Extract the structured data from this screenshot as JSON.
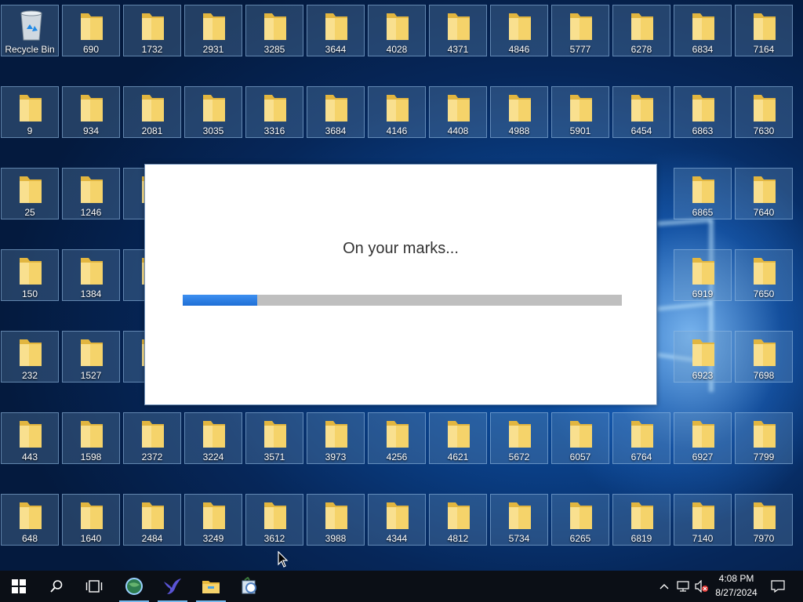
{
  "desktop": {
    "recycle_bin_label": "Recycle Bin",
    "rows": [
      [
        "690",
        "1732",
        "2931",
        "3285",
        "3644",
        "4028",
        "4371",
        "4846",
        "5777",
        "6278",
        "6834",
        "7164"
      ],
      [
        "9",
        "934",
        "2081",
        "3035",
        "3316",
        "3684",
        "4146",
        "4408",
        "4988",
        "5901",
        "6454",
        "6863",
        "7630"
      ],
      [
        "25",
        "1246",
        "6865",
        "7640"
      ],
      [
        "150",
        "1384",
        "6919",
        "7650"
      ],
      [
        "232",
        "1527",
        "6923",
        "7698"
      ],
      [
        "443",
        "1598",
        "2372",
        "3224",
        "3571",
        "3973",
        "4256",
        "4621",
        "5672",
        "6057",
        "6764",
        "6927",
        "7799"
      ],
      [
        "648",
        "1640",
        "2484",
        "3249",
        "3612",
        "3988",
        "4344",
        "4812",
        "5734",
        "6265",
        "6819",
        "7140",
        "7970"
      ]
    ],
    "folder_color": "#f5d36a",
    "icons": {
      "folder": "folder-icon",
      "recycle_bin": "recycle-bin-icon"
    }
  },
  "dialog": {
    "message": "On your marks...",
    "progress_fraction": 0.17,
    "progress_color": "#2f7fe6",
    "track_color": "#bfbfbf"
  },
  "taskbar": {
    "items": [
      {
        "name": "start-button",
        "icon": "windows-logo-icon",
        "active": false
      },
      {
        "name": "search-button",
        "icon": "search-icon",
        "active": false
      },
      {
        "name": "task-view-button",
        "icon": "task-view-icon",
        "active": false
      },
      {
        "name": "app-globe-button",
        "icon": "globe-app-icon",
        "active": true
      },
      {
        "name": "app-bird-button",
        "icon": "bird-app-icon",
        "active": true
      },
      {
        "name": "file-explorer-button",
        "icon": "folder-icon",
        "active": true
      },
      {
        "name": "app-tool-button",
        "icon": "toolbox-app-icon",
        "active": false
      }
    ],
    "tray": {
      "time": "4:08 PM",
      "date": "8/27/2024",
      "icons": [
        "chevron-up-icon",
        "network-icon",
        "speaker-muted-icon",
        "notification-icon"
      ]
    }
  }
}
